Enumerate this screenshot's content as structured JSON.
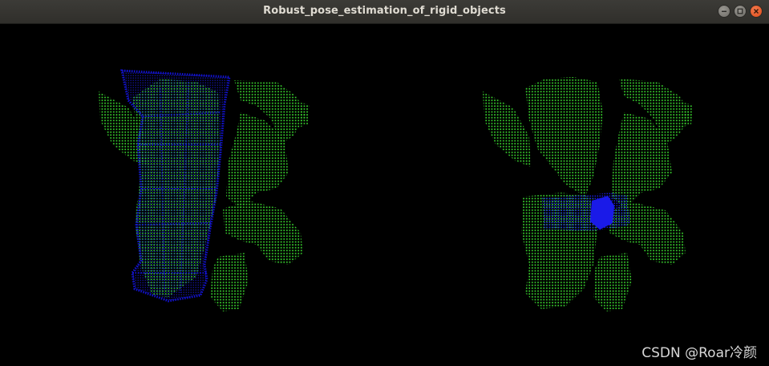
{
  "window": {
    "title": "Robust_pose_estimation_of_rigid_objects"
  },
  "controls": {
    "minimize_icon": "minimize-icon",
    "maximize_icon": "maximize-icon",
    "close_icon": "close-icon"
  },
  "colors": {
    "scene_points": "#39d52e",
    "object_points": "#1414e6",
    "background": "#000000"
  },
  "watermark": {
    "text": "CSDN @Roar冷颜"
  }
}
